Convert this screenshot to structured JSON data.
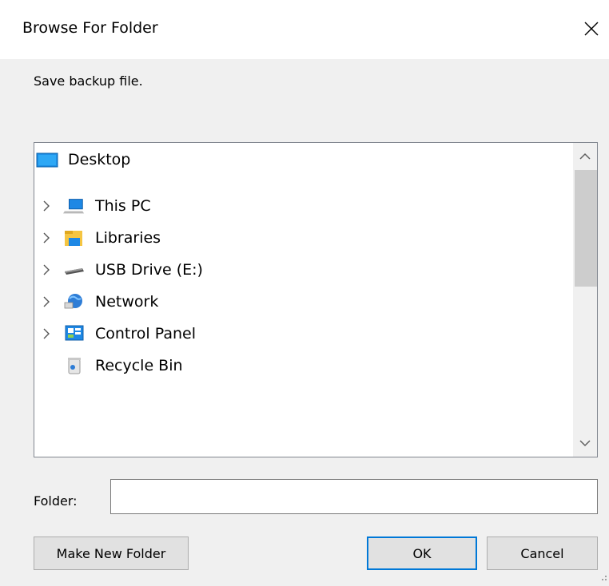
{
  "dialog": {
    "title": "Browse For Folder",
    "instruction": "Save backup file."
  },
  "tree": {
    "items": [
      {
        "label": "Desktop",
        "icon": "desktop-icon",
        "expandable": false
      },
      {
        "label": "This PC",
        "icon": "computer-icon",
        "expandable": true
      },
      {
        "label": "Libraries",
        "icon": "libraries-icon",
        "expandable": true
      },
      {
        "label": "USB Drive (E:)",
        "icon": "usb-drive-icon",
        "expandable": true
      },
      {
        "label": "Network",
        "icon": "network-icon",
        "expandable": true
      },
      {
        "label": "Control Panel",
        "icon": "control-panel-icon",
        "expandable": true
      },
      {
        "label": "Recycle Bin",
        "icon": "recycle-bin-icon",
        "expandable": false
      }
    ]
  },
  "folder": {
    "label": "Folder:",
    "value": ""
  },
  "buttons": {
    "make_new_folder": "Make New Folder",
    "ok": "OK",
    "cancel": "Cancel"
  },
  "colors": {
    "accent": "#0078d7",
    "dialog_bg": "#f0f0f0"
  }
}
